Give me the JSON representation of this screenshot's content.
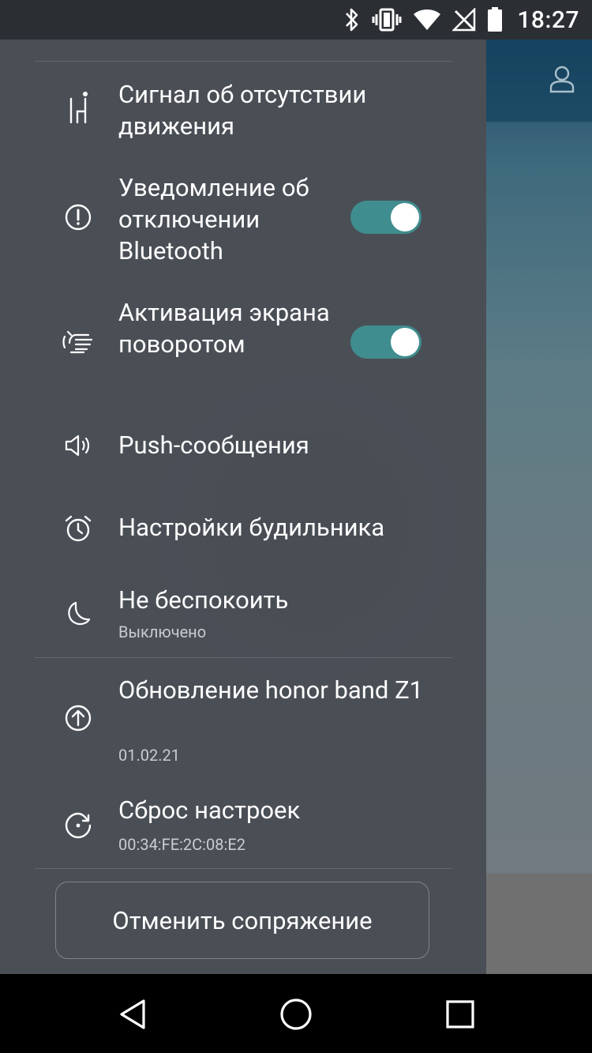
{
  "status_bar": {
    "time": "18:27",
    "icons": [
      "bluetooth-icon",
      "vibrate-icon",
      "wifi-icon",
      "no-signal-icon",
      "battery-icon"
    ]
  },
  "drawer": {
    "items": [
      {
        "name": "inactivity-alert",
        "icon": "person-sitting-icon",
        "label": "Сигнал об отсутствии движения"
      },
      {
        "name": "bluetooth-disconnect-alert",
        "icon": "alert-circle-icon",
        "label": "Уведомление об отключении Bluetooth",
        "toggle": true
      },
      {
        "name": "wrist-wake",
        "icon": "hand-gesture-icon",
        "label": "Активация экрана поворотом",
        "toggle": true
      },
      {
        "name": "push-notifications",
        "icon": "speaker-icon",
        "label": "Push-сообщения"
      },
      {
        "name": "alarm-settings",
        "icon": "alarm-clock-icon",
        "label": "Настройки будильника"
      },
      {
        "name": "do-not-disturb",
        "icon": "moon-icon",
        "label": "Не беспокоить",
        "sublabel": "Выключено"
      },
      {
        "name": "firmware-update",
        "icon": "upload-circle-icon",
        "label": "Обновление honor band Z1",
        "sublabel": "01.02.21"
      },
      {
        "name": "factory-reset",
        "icon": "reset-icon",
        "label": "Сброс настроек",
        "sublabel": "00:34:FE:2C:08:E2"
      }
    ],
    "unpair_label": "Отменить сопряжение"
  },
  "nav_bar": {
    "buttons": [
      "back-icon",
      "home-icon",
      "recents-icon"
    ]
  },
  "colors": {
    "drawer_bg": "#4a4f56",
    "toggle_on": "#3f8d8f",
    "status_bar_bg": "#2b2e33"
  }
}
